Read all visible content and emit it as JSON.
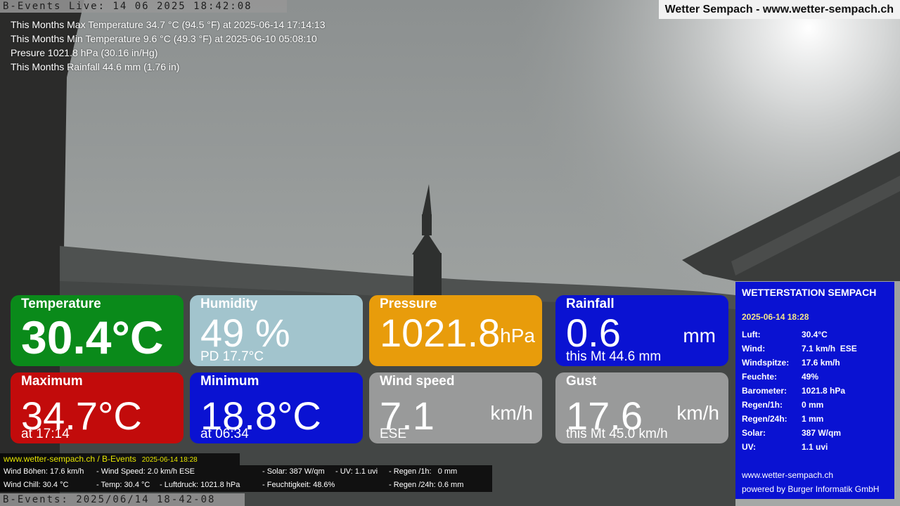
{
  "camera": {
    "stamp_top": "B-Events Live: 14 06 2025 18:42:08",
    "stamp_bottom": "B-Events: 2025/06/14 18-42-08"
  },
  "header": {
    "title": "Wetter Sempach - www.wetter-sempach.ch"
  },
  "stats": {
    "max_temp": "This Months Max Temperature 34.7 °C (94.5 °F) at 2025-06-14 17:14:13",
    "min_temp": "This Months Min Temperature 9.6 °C (49.3 °F) at 2025-06-10 05:08:10",
    "pressure": "Presure 1021.8 hPa (30.16 in/Hg)",
    "rainfall": "This Months Rainfall 44.6 mm (1.76 in)"
  },
  "tiles": {
    "temperature": {
      "title": "Temperature",
      "value": "30.4°C"
    },
    "humidity": {
      "title": "Humidity",
      "value": "49 %",
      "sub": "PD 17.7°C"
    },
    "pressure": {
      "title": "Pressure",
      "value": "1021.8",
      "unit": "hPa"
    },
    "rainfall": {
      "title": "Rainfall",
      "value": "0.6",
      "unit": "mm",
      "sub": "this Mt 44.6 mm"
    },
    "maximum": {
      "title": "Maximum",
      "value": "34.7°C",
      "sub": "at 17:14"
    },
    "minimum": {
      "title": "Minimum",
      "value": "18.8°C",
      "sub": "at 06:34"
    },
    "wind_speed": {
      "title": "Wind speed",
      "value": "7.1",
      "unit": "km/h",
      "sub": "ESE"
    },
    "gust": {
      "title": "Gust",
      "value": "17.6",
      "unit": "km/h",
      "sub": "this Mt 45.0 km/h"
    }
  },
  "station": {
    "title": "WETTERSTATION SEMPACH",
    "date": "2025-06-14 18:28",
    "rows": [
      {
        "k": "Luft:",
        "v": "30.4°C"
      },
      {
        "k": "Wind:",
        "v": "7.1 km/h  ESE"
      },
      {
        "k": "Windspitze:",
        "v": "17.6 km/h"
      },
      {
        "k": "Feuchte:",
        "v": "49%"
      },
      {
        "k": "Barometer:",
        "v": "1021.8 hPa"
      },
      {
        "k": "Regen/1h:",
        "v": "0 mm"
      },
      {
        "k": "Regen/24h:",
        "v": "1 mm"
      },
      {
        "k": "Solar:",
        "v": "387 W/qm"
      },
      {
        "k": "UV:",
        "v": "1.1 uvi"
      }
    ],
    "url": "www.wetter-sempach.ch",
    "powered": "powered by Burger Informatik GmbH"
  },
  "ticker": {
    "site": "www.wetter-sempach.ch / B-Events",
    "date": "2025-06-14 18:28",
    "wind_boehen": "Wind Böhen: 17.6 km/h",
    "wind_speed": "- Wind Speed: 2.0 km/h ESE",
    "solar": "- Solar: 387 W/qm",
    "uv": "- UV: 1.1 uvi",
    "regen_1h": "- Regen /1h:   0 mm",
    "wind_chill": "Wind Chill: 30.4 °C",
    "temp": "- Temp: 30.4 °C",
    "luftdruck": "- Luftdruck: 1021.8 hPa",
    "feuchtigkeit": "- Feuchtigkeit: 48.6%",
    "regen_24h": "- Regen /24h: 0.6 mm"
  }
}
